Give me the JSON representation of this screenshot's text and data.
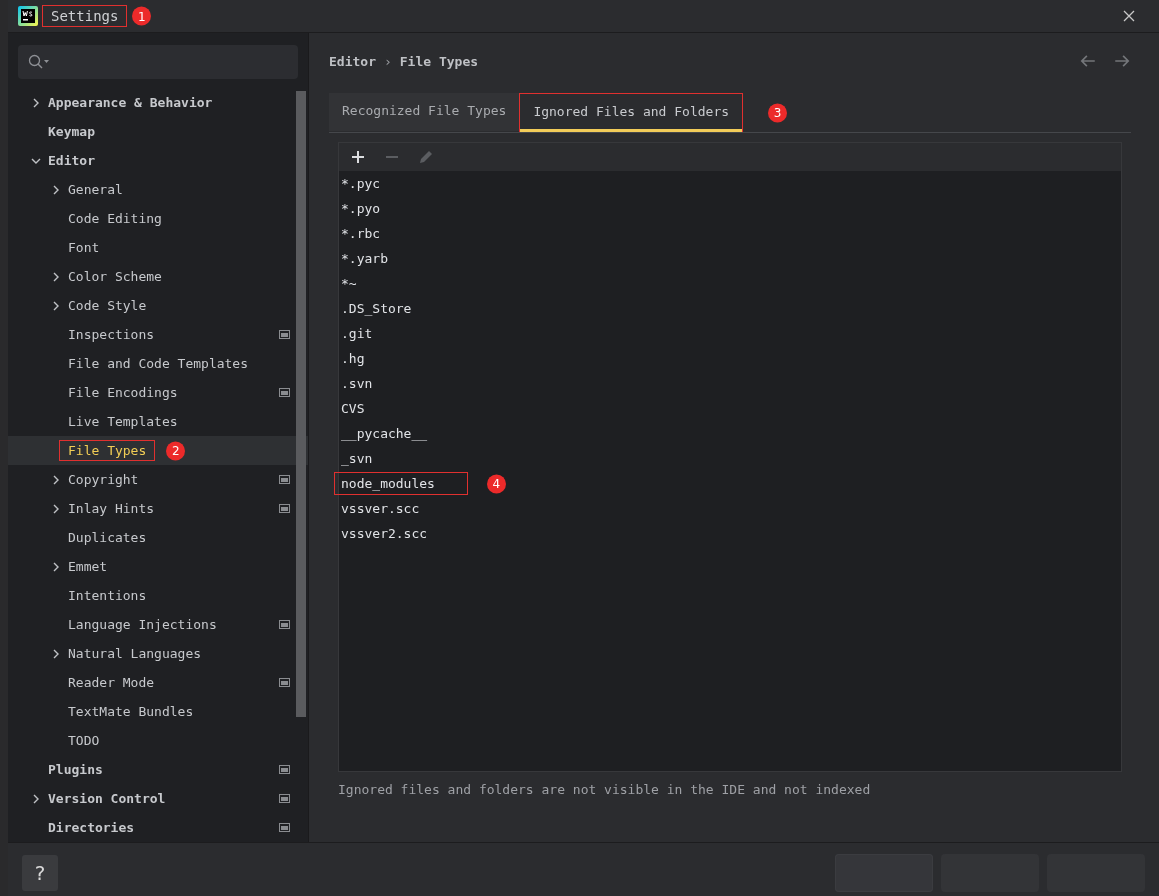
{
  "window": {
    "title": "Settings",
    "callout": "1"
  },
  "tree": [
    {
      "label": "Appearance & Behavior",
      "expanded": false,
      "selected": false,
      "project_scope": false
    },
    {
      "label": "Keymap",
      "selected": false,
      "project_scope": false
    },
    {
      "label": "Editor",
      "expanded": true,
      "selected": false,
      "project_scope": false,
      "children": [
        {
          "label": "General",
          "expanded": false,
          "selected": false,
          "project_scope": false
        },
        {
          "label": "Code Editing",
          "selected": false,
          "project_scope": false
        },
        {
          "label": "Font",
          "selected": false,
          "project_scope": false
        },
        {
          "label": "Color Scheme",
          "expanded": false,
          "selected": false,
          "project_scope": false
        },
        {
          "label": "Code Style",
          "expanded": false,
          "selected": false,
          "project_scope": false
        },
        {
          "label": "Inspections",
          "selected": false,
          "project_scope": true
        },
        {
          "label": "File and Code Templates",
          "selected": false,
          "project_scope": false
        },
        {
          "label": "File Encodings",
          "selected": false,
          "project_scope": true
        },
        {
          "label": "Live Templates",
          "selected": false,
          "project_scope": false
        },
        {
          "label": "File Types",
          "selected": true,
          "project_scope": false,
          "callout": "2"
        },
        {
          "label": "Copyright",
          "expanded": false,
          "selected": false,
          "project_scope": true
        },
        {
          "label": "Inlay Hints",
          "expanded": false,
          "selected": false,
          "project_scope": true
        },
        {
          "label": "Duplicates",
          "selected": false,
          "project_scope": false
        },
        {
          "label": "Emmet",
          "expanded": false,
          "selected": false,
          "project_scope": false
        },
        {
          "label": "Intentions",
          "selected": false,
          "project_scope": false
        },
        {
          "label": "Language Injections",
          "selected": false,
          "project_scope": true
        },
        {
          "label": "Natural Languages",
          "expanded": false,
          "selected": false,
          "project_scope": false
        },
        {
          "label": "Reader Mode",
          "selected": false,
          "project_scope": true
        },
        {
          "label": "TextMate Bundles",
          "selected": false,
          "project_scope": false
        },
        {
          "label": "TODO",
          "selected": false,
          "project_scope": false
        }
      ]
    },
    {
      "label": "Plugins",
      "selected": false,
      "project_scope": true
    },
    {
      "label": "Version Control",
      "expanded": false,
      "selected": false,
      "project_scope": true
    },
    {
      "label": "Directories",
      "selected": false,
      "project_scope": true
    }
  ],
  "breadcrumb": [
    "Editor",
    "›",
    "File Types"
  ],
  "tabs": [
    {
      "label": "Recognized File Types",
      "selected": false
    },
    {
      "label": "Ignored Files and Folders",
      "selected": true,
      "callout": "3"
    }
  ],
  "ignored": [
    {
      "label": "*.pyc"
    },
    {
      "label": "*.pyo"
    },
    {
      "label": "*.rbc"
    },
    {
      "label": "*.yarb"
    },
    {
      "label": "*~"
    },
    {
      "label": ".DS_Store"
    },
    {
      "label": ".git"
    },
    {
      "label": ".hg"
    },
    {
      "label": ".svn"
    },
    {
      "label": "CVS"
    },
    {
      "label": "__pycache__"
    },
    {
      "label": "_svn"
    },
    {
      "label": "node_modules",
      "callout": "4"
    },
    {
      "label": "vssver.scc"
    },
    {
      "label": "vssver2.scc"
    }
  ],
  "note": "Ignored files and folders are not visible in the IDE and not indexed",
  "help": "?",
  "buttons": [
    {
      "kind": "default"
    },
    {
      "kind": "plain"
    },
    {
      "kind": "plain"
    }
  ]
}
